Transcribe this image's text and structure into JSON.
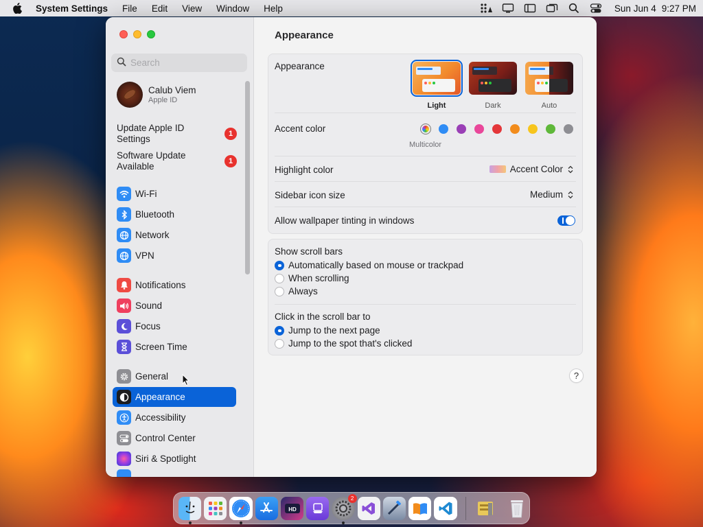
{
  "menubar": {
    "app_name": "System Settings",
    "menus": [
      "File",
      "Edit",
      "View",
      "Window",
      "Help"
    ],
    "date": "Sun Jun 4",
    "time": "9:27 PM"
  },
  "sidebar": {
    "search_placeholder": "Search",
    "profile": {
      "name": "Calub Viem",
      "subtitle": "Apple ID"
    },
    "notices": [
      {
        "label": "Update Apple ID Settings",
        "badge": "1"
      },
      {
        "label": "Software Update Available",
        "badge": "1"
      }
    ],
    "items": [
      {
        "label": "Wi-Fi",
        "icon": "wifi-icon",
        "color": "#2f8cf5"
      },
      {
        "label": "Bluetooth",
        "icon": "bluetooth-icon",
        "color": "#2f8cf5"
      },
      {
        "label": "Network",
        "icon": "globe-icon",
        "color": "#2f8cf5"
      },
      {
        "label": "VPN",
        "icon": "globe-icon",
        "color": "#2f8cf5"
      },
      {
        "label": "Notifications",
        "icon": "bell-icon",
        "color": "#ef4a43"
      },
      {
        "label": "Sound",
        "icon": "speaker-icon",
        "color": "#ef3f5e"
      },
      {
        "label": "Focus",
        "icon": "moon-icon",
        "color": "#5b4fd8"
      },
      {
        "label": "Screen Time",
        "icon": "hourglass-icon",
        "color": "#5b4fd8"
      },
      {
        "label": "General",
        "icon": "gear-icon",
        "color": "#8e8e93"
      },
      {
        "label": "Appearance",
        "icon": "appearance-icon",
        "color": "#1d1d1f"
      },
      {
        "label": "Accessibility",
        "icon": "accessibility-icon",
        "color": "#2f8cf5"
      },
      {
        "label": "Control Center",
        "icon": "switches-icon",
        "color": "#8e8e93"
      },
      {
        "label": "Siri & Spotlight",
        "icon": "siri-icon",
        "color": "#c23fd8"
      }
    ]
  },
  "main": {
    "title": "Appearance",
    "appearance_label": "Appearance",
    "modes": [
      "Light",
      "Dark",
      "Auto"
    ],
    "accent_label": "Accent color",
    "accent_selected_name": "Multicolor",
    "accent_colors": [
      "#2f8cf5",
      "#9a3fb6",
      "#e9479a",
      "#e4373a",
      "#f28c1c",
      "#f7c51d",
      "#5fb83a",
      "#8e8e93"
    ],
    "highlight_label": "Highlight color",
    "highlight_value": "Accent Color",
    "icon_size_label": "Sidebar icon size",
    "icon_size_value": "Medium",
    "tinting_label": "Allow wallpaper tinting in windows",
    "tinting_on": true,
    "scroll_bars_label": "Show scroll bars",
    "scroll_bar_options": [
      "Automatically based on mouse or trackpad",
      "When scrolling",
      "Always"
    ],
    "click_label": "Click in the scroll bar to",
    "click_options": [
      "Jump to the next page",
      "Jump to the spot that's clicked"
    ],
    "help": "?"
  },
  "dock": {
    "apps": [
      "finder-icon",
      "launchpad-icon",
      "safari-icon",
      "app-store-icon",
      "hd-icon",
      "stack-icon",
      "system-settings-icon",
      "visual-studio-icon",
      "xcode-tools-icon",
      "books-icon",
      "vscode-icon",
      "archive-icon",
      "trash-icon"
    ],
    "settings_badge": "2"
  }
}
